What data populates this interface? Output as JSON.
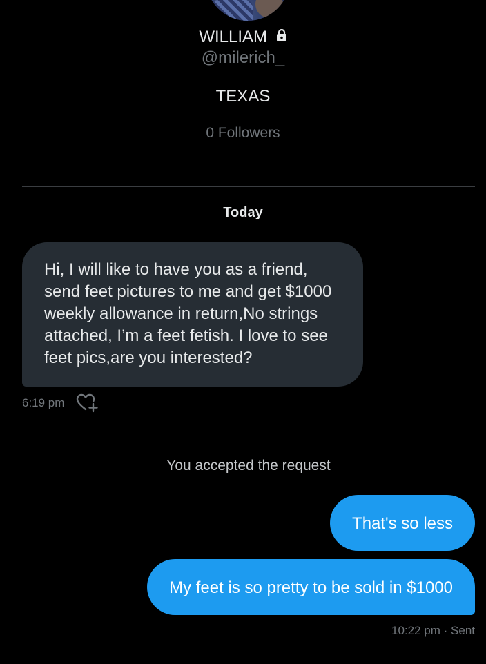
{
  "profile": {
    "name": "WILLIAM",
    "handle": "@milerich_",
    "location": "TEXAS",
    "followers": "0 Followers",
    "locked_icon": "lock-icon"
  },
  "conversation": {
    "date_label": "Today",
    "incoming": {
      "text": "Hi, I will like to have you as a friend, send feet pictures to me and get $1000 weekly allowance in return,No strings attached, I’m a feet fetish. I love to see feet pics,are you interested?",
      "time": "6:19 pm",
      "react_icon": "heart-plus-icon"
    },
    "system_note": "You accepted the request",
    "outgoing": [
      {
        "text": "That's so less"
      },
      {
        "text": "My feet is so pretty to be sold in $1000"
      }
    ],
    "outgoing_meta": "10:22 pm · Sent"
  },
  "colors": {
    "background": "#000000",
    "incoming_bubble": "#262d34",
    "outgoing_bubble": "#1d9bf0",
    "muted_text": "#71767b",
    "primary_text": "#e7e9ea"
  }
}
